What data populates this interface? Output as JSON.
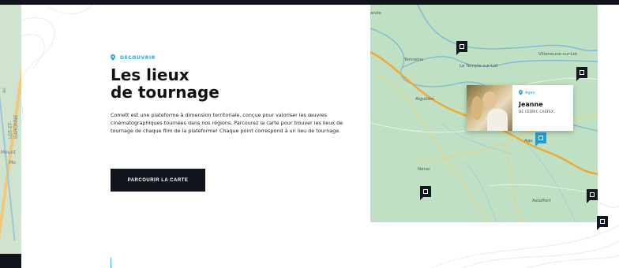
{
  "left_map": {
    "labels": [
      "Mount",
      "Mo",
      "LOT-ET-GARONNE",
      "ac"
    ]
  },
  "content": {
    "kicker": "DÉCOUVRIR",
    "title_line1": "Les lieux",
    "title_line2": "de tournage",
    "description": "Comett est une plateforme à dimension territoriale, conçue pour valoriser les œuvres cinématographiques tournées dans nos régions. Parcourez la carte pour trouver les lieux de tournage de chaque film de la plateforme! Chaque point correspond à un lieu de tournage.",
    "cta_label": "PARCOURIR LA CARTE"
  },
  "map": {
    "towns": {
      "t1": "ande",
      "t2": "Tonneins",
      "t3": "Le Temple-sur-Lot",
      "t4": "Villeneuve-sur-Lot",
      "t5": "Aiguillon",
      "t6": "Age",
      "t7": "Nérac",
      "t8": "Astaffort"
    },
    "card": {
      "location": "Agen",
      "film_title": "Jeanne",
      "director": "DE CÉDRIC CASTEX"
    },
    "colors": {
      "land": "#bfe0c2",
      "road": "#f0a830",
      "river": "#7fb9dc",
      "marker": "#141821",
      "marker_active": "#1f9fd6"
    }
  }
}
